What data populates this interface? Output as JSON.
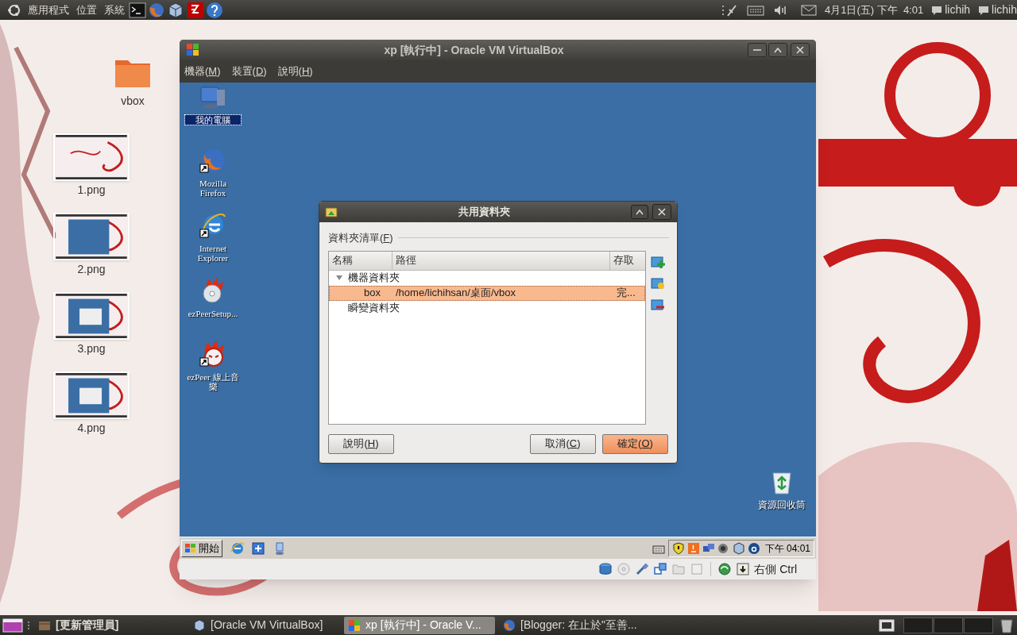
{
  "top_panel": {
    "menus": [
      "應用程式",
      "位置",
      "系統"
    ],
    "clock": "4月1日(五) 下午  4:01",
    "users": [
      "lichih",
      "lichih"
    ]
  },
  "desktop_icons": [
    {
      "kind": "folder",
      "label": "vbox"
    },
    {
      "kind": "picture",
      "label": "1.png"
    },
    {
      "kind": "picture",
      "label": "2.png"
    },
    {
      "kind": "picture",
      "label": "3.png"
    },
    {
      "kind": "picture",
      "label": "4.png"
    }
  ],
  "vm_window": {
    "title": "xp [執行中] - Oracle VM VirtualBox",
    "menus": [
      [
        "機器(",
        "M",
        ")"
      ],
      [
        "裝置(",
        "D",
        ")"
      ],
      [
        "說明(",
        "H",
        ")"
      ]
    ],
    "guest_icons": [
      {
        "kind": "computer",
        "label": "我的電腦",
        "selected": true
      },
      {
        "kind": "firefox",
        "label": "Mozilla Firefox",
        "selected": false
      },
      {
        "kind": "ie",
        "label": "Internet Explorer",
        "selected": false
      },
      {
        "kind": "ezpeer_setup",
        "label": "ezPeerSetup...",
        "selected": false
      },
      {
        "kind": "ezpeer",
        "label": "ezPeer 線上音樂",
        "selected": false
      },
      {
        "kind": "recycle",
        "label": "資源回收筒",
        "selected": false
      }
    ],
    "dialog": {
      "title": "共用資料夾",
      "group_label": [
        "資料夾清單(",
        "F",
        ")"
      ],
      "columns": [
        "名稱",
        "路徑",
        "存取"
      ],
      "tree": [
        {
          "name": "機器資料夾",
          "expanded": true,
          "children": [
            {
              "name": "box",
              "path": "/home/lichihsan/桌面/vbox",
              "access": "完...",
              "selected": true
            }
          ]
        },
        {
          "name": "瞬變資料夾"
        }
      ],
      "buttons": [
        {
          "parts": [
            "說明(",
            "H",
            ")"
          ],
          "focused": false
        },
        {
          "parts": [
            "取消(",
            "C",
            ")"
          ],
          "focused": false
        },
        {
          "parts": [
            "確定(",
            "O",
            ")"
          ],
          "focused": true
        }
      ]
    },
    "guest_taskbar": {
      "start": "開始",
      "clock": "下午 04:01"
    },
    "status_bar": {
      "host_key": "右側 Ctrl"
    }
  },
  "bottom_panel": {
    "tasks": [
      {
        "label": "[更新管理員]",
        "bold": true,
        "selected": false
      },
      {
        "label": "[Oracle VM VirtualBox]",
        "bold": false,
        "selected": false
      },
      {
        "label": "xp [執行中] - Oracle V...",
        "bold": false,
        "selected": true
      },
      {
        "label": "[Blogger: 在止於\"至善...",
        "bold": false,
        "selected": false
      }
    ]
  }
}
